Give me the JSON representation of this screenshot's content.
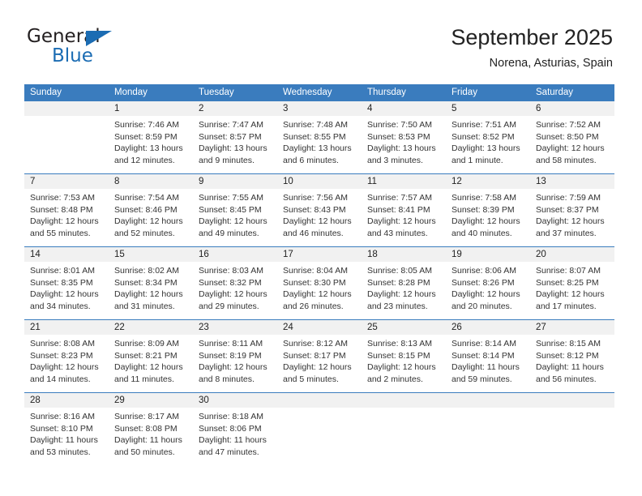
{
  "brand": {
    "word1": "General",
    "word2": "Blue",
    "accent_color": "#1b6cb3",
    "triangle_icon": "triangle-icon"
  },
  "header": {
    "title": "September 2025",
    "subtitle": "Norena, Asturias, Spain"
  },
  "calendar": {
    "header_color": "#3a7cbe",
    "daynum_bg": "#f1f1f1",
    "day_names": [
      "Sunday",
      "Monday",
      "Tuesday",
      "Wednesday",
      "Thursday",
      "Friday",
      "Saturday"
    ],
    "weeks": [
      {
        "days": [
          {
            "num": "",
            "empty": true,
            "lines": []
          },
          {
            "num": "1",
            "lines": [
              "Sunrise: 7:46 AM",
              "Sunset: 8:59 PM",
              "Daylight: 13 hours",
              "and 12 minutes."
            ]
          },
          {
            "num": "2",
            "lines": [
              "Sunrise: 7:47 AM",
              "Sunset: 8:57 PM",
              "Daylight: 13 hours",
              "and 9 minutes."
            ]
          },
          {
            "num": "3",
            "lines": [
              "Sunrise: 7:48 AM",
              "Sunset: 8:55 PM",
              "Daylight: 13 hours",
              "and 6 minutes."
            ]
          },
          {
            "num": "4",
            "lines": [
              "Sunrise: 7:50 AM",
              "Sunset: 8:53 PM",
              "Daylight: 13 hours",
              "and 3 minutes."
            ]
          },
          {
            "num": "5",
            "lines": [
              "Sunrise: 7:51 AM",
              "Sunset: 8:52 PM",
              "Daylight: 13 hours",
              "and 1 minute."
            ]
          },
          {
            "num": "6",
            "lines": [
              "Sunrise: 7:52 AM",
              "Sunset: 8:50 PM",
              "Daylight: 12 hours",
              "and 58 minutes."
            ]
          }
        ]
      },
      {
        "days": [
          {
            "num": "7",
            "lines": [
              "Sunrise: 7:53 AM",
              "Sunset: 8:48 PM",
              "Daylight: 12 hours",
              "and 55 minutes."
            ]
          },
          {
            "num": "8",
            "lines": [
              "Sunrise: 7:54 AM",
              "Sunset: 8:46 PM",
              "Daylight: 12 hours",
              "and 52 minutes."
            ]
          },
          {
            "num": "9",
            "lines": [
              "Sunrise: 7:55 AM",
              "Sunset: 8:45 PM",
              "Daylight: 12 hours",
              "and 49 minutes."
            ]
          },
          {
            "num": "10",
            "lines": [
              "Sunrise: 7:56 AM",
              "Sunset: 8:43 PM",
              "Daylight: 12 hours",
              "and 46 minutes."
            ]
          },
          {
            "num": "11",
            "lines": [
              "Sunrise: 7:57 AM",
              "Sunset: 8:41 PM",
              "Daylight: 12 hours",
              "and 43 minutes."
            ]
          },
          {
            "num": "12",
            "lines": [
              "Sunrise: 7:58 AM",
              "Sunset: 8:39 PM",
              "Daylight: 12 hours",
              "and 40 minutes."
            ]
          },
          {
            "num": "13",
            "lines": [
              "Sunrise: 7:59 AM",
              "Sunset: 8:37 PM",
              "Daylight: 12 hours",
              "and 37 minutes."
            ]
          }
        ]
      },
      {
        "days": [
          {
            "num": "14",
            "lines": [
              "Sunrise: 8:01 AM",
              "Sunset: 8:35 PM",
              "Daylight: 12 hours",
              "and 34 minutes."
            ]
          },
          {
            "num": "15",
            "lines": [
              "Sunrise: 8:02 AM",
              "Sunset: 8:34 PM",
              "Daylight: 12 hours",
              "and 31 minutes."
            ]
          },
          {
            "num": "16",
            "lines": [
              "Sunrise: 8:03 AM",
              "Sunset: 8:32 PM",
              "Daylight: 12 hours",
              "and 29 minutes."
            ]
          },
          {
            "num": "17",
            "lines": [
              "Sunrise: 8:04 AM",
              "Sunset: 8:30 PM",
              "Daylight: 12 hours",
              "and 26 minutes."
            ]
          },
          {
            "num": "18",
            "lines": [
              "Sunrise: 8:05 AM",
              "Sunset: 8:28 PM",
              "Daylight: 12 hours",
              "and 23 minutes."
            ]
          },
          {
            "num": "19",
            "lines": [
              "Sunrise: 8:06 AM",
              "Sunset: 8:26 PM",
              "Daylight: 12 hours",
              "and 20 minutes."
            ]
          },
          {
            "num": "20",
            "lines": [
              "Sunrise: 8:07 AM",
              "Sunset: 8:25 PM",
              "Daylight: 12 hours",
              "and 17 minutes."
            ]
          }
        ]
      },
      {
        "days": [
          {
            "num": "21",
            "lines": [
              "Sunrise: 8:08 AM",
              "Sunset: 8:23 PM",
              "Daylight: 12 hours",
              "and 14 minutes."
            ]
          },
          {
            "num": "22",
            "lines": [
              "Sunrise: 8:09 AM",
              "Sunset: 8:21 PM",
              "Daylight: 12 hours",
              "and 11 minutes."
            ]
          },
          {
            "num": "23",
            "lines": [
              "Sunrise: 8:11 AM",
              "Sunset: 8:19 PM",
              "Daylight: 12 hours",
              "and 8 minutes."
            ]
          },
          {
            "num": "24",
            "lines": [
              "Sunrise: 8:12 AM",
              "Sunset: 8:17 PM",
              "Daylight: 12 hours",
              "and 5 minutes."
            ]
          },
          {
            "num": "25",
            "lines": [
              "Sunrise: 8:13 AM",
              "Sunset: 8:15 PM",
              "Daylight: 12 hours",
              "and 2 minutes."
            ]
          },
          {
            "num": "26",
            "lines": [
              "Sunrise: 8:14 AM",
              "Sunset: 8:14 PM",
              "Daylight: 11 hours",
              "and 59 minutes."
            ]
          },
          {
            "num": "27",
            "lines": [
              "Sunrise: 8:15 AM",
              "Sunset: 8:12 PM",
              "Daylight: 11 hours",
              "and 56 minutes."
            ]
          }
        ]
      },
      {
        "days": [
          {
            "num": "28",
            "lines": [
              "Sunrise: 8:16 AM",
              "Sunset: 8:10 PM",
              "Daylight: 11 hours",
              "and 53 minutes."
            ]
          },
          {
            "num": "29",
            "lines": [
              "Sunrise: 8:17 AM",
              "Sunset: 8:08 PM",
              "Daylight: 11 hours",
              "and 50 minutes."
            ]
          },
          {
            "num": "30",
            "lines": [
              "Sunrise: 8:18 AM",
              "Sunset: 8:06 PM",
              "Daylight: 11 hours",
              "and 47 minutes."
            ]
          },
          {
            "num": "",
            "empty": true,
            "lines": []
          },
          {
            "num": "",
            "empty": true,
            "lines": []
          },
          {
            "num": "",
            "empty": true,
            "lines": []
          },
          {
            "num": "",
            "empty": true,
            "lines": []
          }
        ]
      }
    ]
  }
}
